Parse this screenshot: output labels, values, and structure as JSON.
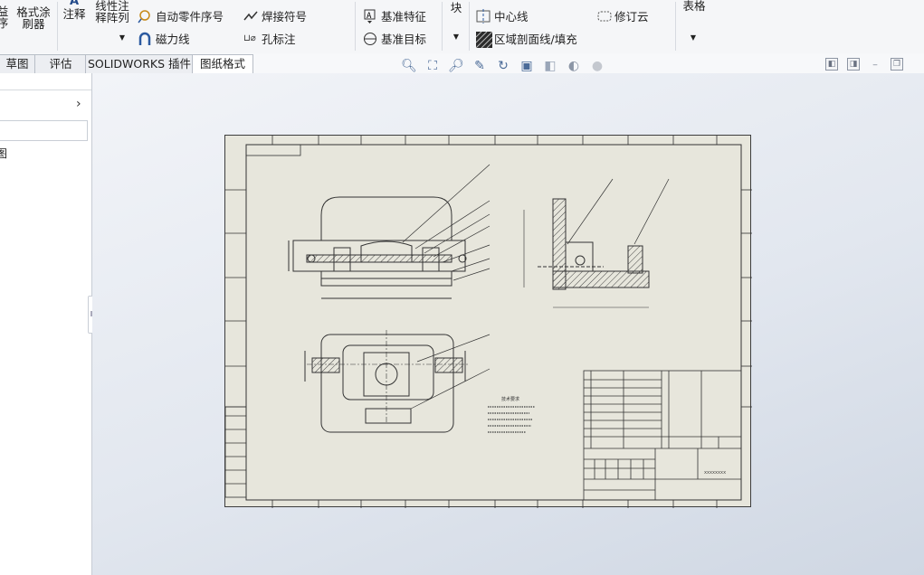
{
  "ribbon": {
    "partial_left_1": "益\n序",
    "format_painter": "格式涂\n刷器",
    "note": "注释",
    "linear_note_pattern": "线性注\n释阵列",
    "auto_balloon": "自动零件序号",
    "magnetic_line": "磁力线",
    "weld_symbol": "焊接符号",
    "hole_callout": "孔标注",
    "datum_feature": "基准特征",
    "datum_target": "基准目标",
    "block": "块",
    "centerline": "中心线",
    "area_hatch": "区域剖面线/填充",
    "revision_cloud": "修订云",
    "table": "表格"
  },
  "tabs": [
    "草图",
    "评估",
    "SOLIDWORKS 插件",
    "图纸格式"
  ],
  "view_toolbar": {
    "icons": [
      "zoom-to-fit-icon",
      "zoom-to-area-icon",
      "zoom-in-out-icon",
      "select-icon",
      "rotate-icon",
      "section-view-icon",
      "display-style-icon",
      "hide-show-icon",
      "appearance-icon"
    ]
  },
  "left_panel": {
    "partial_label": "图"
  },
  "drawing": {
    "notes_title": "技术要求",
    "title_block_company": "xxxxxxxx"
  },
  "colors": {
    "sheet_bg": "#e7e6dc",
    "line": "#333333",
    "hatch": "#444444"
  }
}
